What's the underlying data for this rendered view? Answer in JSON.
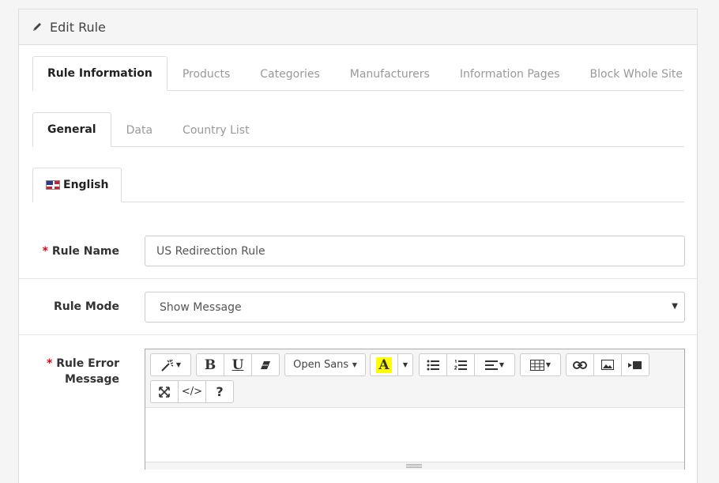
{
  "panel": {
    "title": "Edit Rule"
  },
  "main_tabs": [
    "Rule Information",
    "Products",
    "Categories",
    "Manufacturers",
    "Information Pages",
    "Block Whole Site"
  ],
  "sub_tabs": [
    "General",
    "Data",
    "Country List"
  ],
  "language_tab": {
    "label": "English",
    "flag": "uk-flag-icon"
  },
  "form": {
    "rule_name": {
      "required_mark": "*",
      "label": "Rule Name",
      "value": "US Redirection Rule"
    },
    "rule_mode": {
      "label": "Rule Mode",
      "value": "Show Message"
    },
    "rule_error_message": {
      "required_mark": "*",
      "label_line1": "Rule Error",
      "label_line2": "Message"
    }
  },
  "editor": {
    "font_name": "Open Sans",
    "bold": "B",
    "underline": "U",
    "code_view": "</>",
    "help": "?"
  },
  "colors": {
    "required": "#e3000f",
    "highlight_swatch": "#ffff00"
  }
}
